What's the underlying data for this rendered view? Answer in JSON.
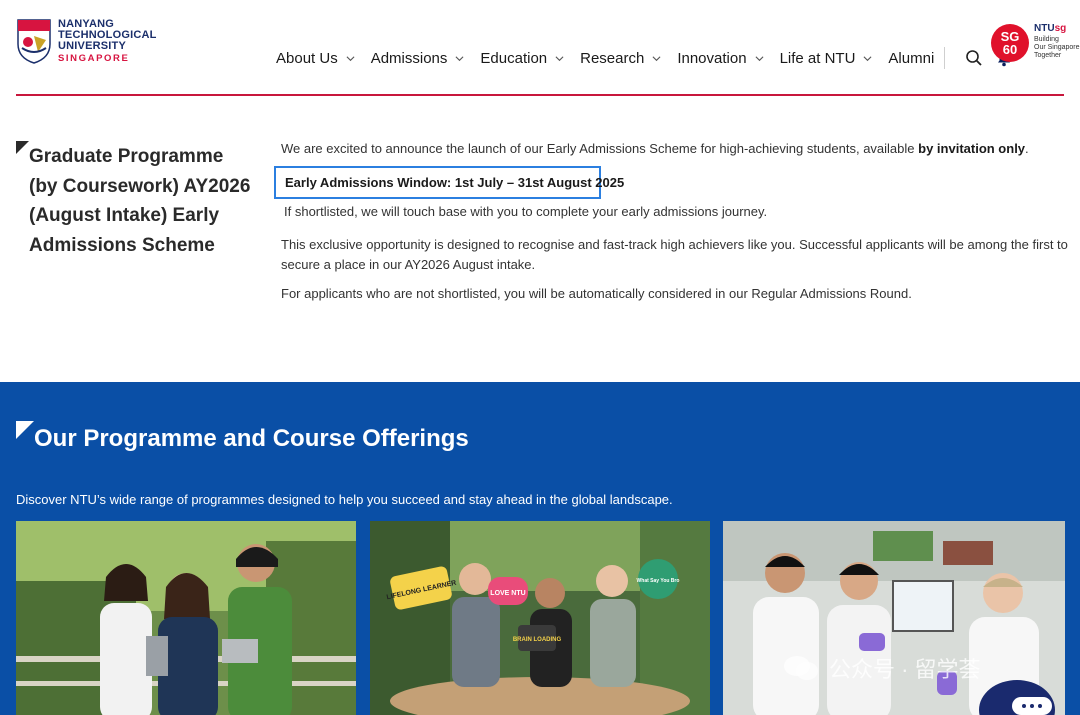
{
  "header": {
    "logo_lines": [
      "NANYANG",
      "TECHNOLOGICAL",
      "UNIVERSITY"
    ],
    "logo_sub": "SINGAPORE",
    "nav": [
      {
        "label": "About Us",
        "chevron": true
      },
      {
        "label": "Admissions",
        "chevron": true
      },
      {
        "label": "Education",
        "chevron": true
      },
      {
        "label": "Research",
        "chevron": true
      },
      {
        "label": "Innovation",
        "chevron": true
      },
      {
        "label": "Life at NTU",
        "chevron": true
      },
      {
        "label": "Alumni",
        "chevron": false
      }
    ],
    "sg60": {
      "line1": "SG",
      "line2": "60"
    },
    "ntusg": {
      "prefix": "NTU",
      "suffix": "sg",
      "tag": [
        "Building",
        "Our Singapore",
        "Together"
      ]
    },
    "accent": "#c8163c"
  },
  "intro": {
    "title": "Graduate Programme (by Coursework) AY2026 (August Intake) Early Admissions Scheme",
    "p1_text": "We are excited to announce the launch of our Early Admissions Scheme for high-achieving students, available ",
    "p1_bold": "by invitation only",
    "p1_end": ".",
    "window": "Early Admissions Window: 1st July – 31st August 2025",
    "p2": "If shortlisted, we will touch base with you to complete your early admissions journey.",
    "p3": "This exclusive opportunity is designed to recognise and fast-track high achievers like you. Successful applicants will be among the first to secure a place in our AY2026 August intake.",
    "p4": "For applicants who are not shortlisted, you will be automatically considered in our Regular Admissions Round.",
    "highlight_color": "#2b7fe0"
  },
  "offerings": {
    "title": "Our Programme and Course Offerings",
    "description": "Discover NTU’s wide range of programmes designed to help you succeed and stay ahead in the global landscape.",
    "bg_color": "#0a4fa6",
    "cards": [
      {
        "image": "students-outdoors-photo",
        "signs": []
      },
      {
        "image": "students-with-signs-photo",
        "signs": [
          "LIFELONG LEARNER",
          "LOVE NTU",
          "BRAIN LOADING",
          "What Say You Bro"
        ]
      },
      {
        "image": "lab-researchers-photo",
        "signs": []
      }
    ]
  },
  "watermark": {
    "text": "公众号 · 留学荟"
  }
}
